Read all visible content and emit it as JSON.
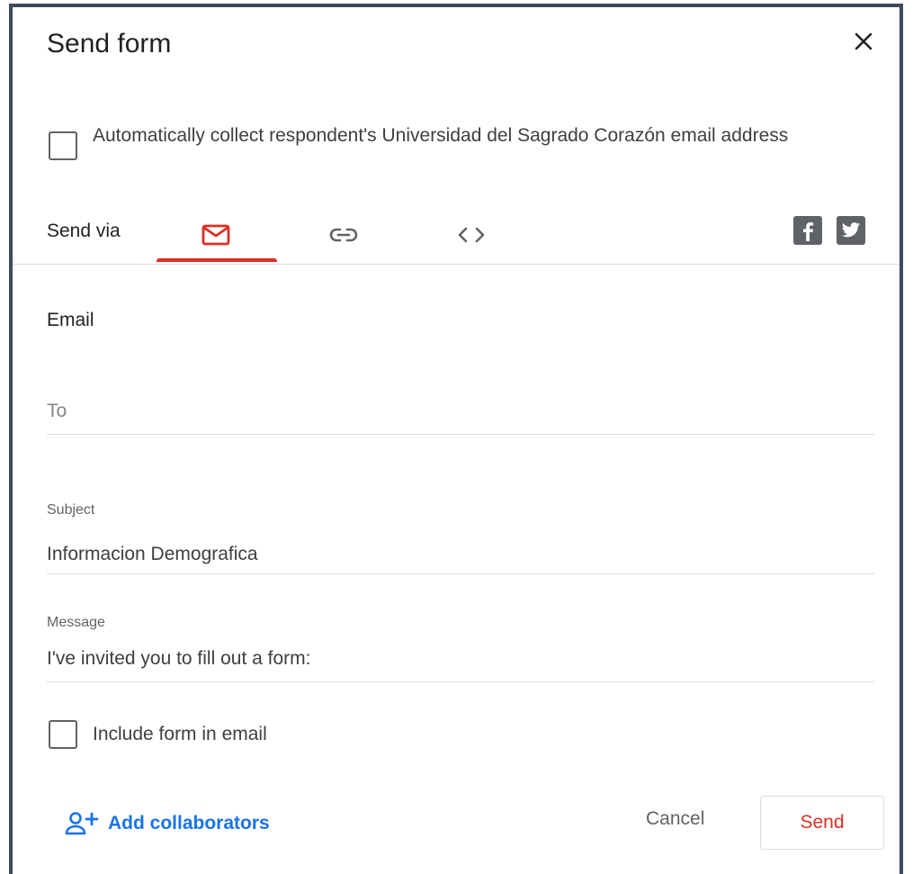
{
  "dialog": {
    "title": "Send form",
    "close_icon": "close-icon"
  },
  "collect_email": {
    "label": "Automatically collect respondent's Universidad del Sagrado Corazón email address",
    "checked": false
  },
  "send_via": {
    "label": "Send via",
    "tabs": [
      {
        "name": "email",
        "icon": "mail-icon",
        "active": true
      },
      {
        "name": "link",
        "icon": "link-icon",
        "active": false
      },
      {
        "name": "embed",
        "icon": "code-icon",
        "active": false
      }
    ],
    "social": [
      {
        "name": "facebook",
        "icon": "facebook-icon"
      },
      {
        "name": "twitter",
        "icon": "twitter-icon"
      }
    ]
  },
  "email": {
    "section_title": "Email",
    "to": {
      "placeholder": "To",
      "value": ""
    },
    "subject": {
      "label": "Subject",
      "value": "Informacion Demografica"
    },
    "message": {
      "label": "Message",
      "value": "I've invited you to fill out a form:"
    },
    "include_form": {
      "label": "Include form in email",
      "checked": false
    }
  },
  "footer": {
    "add_collaborators": "Add collaborators",
    "cancel": "Cancel",
    "send": "Send"
  },
  "colors": {
    "accent_red": "#d93025",
    "link_blue": "#1a73e8",
    "icon_gray": "#5f6368",
    "dialog_border": "#3c4a5c"
  }
}
